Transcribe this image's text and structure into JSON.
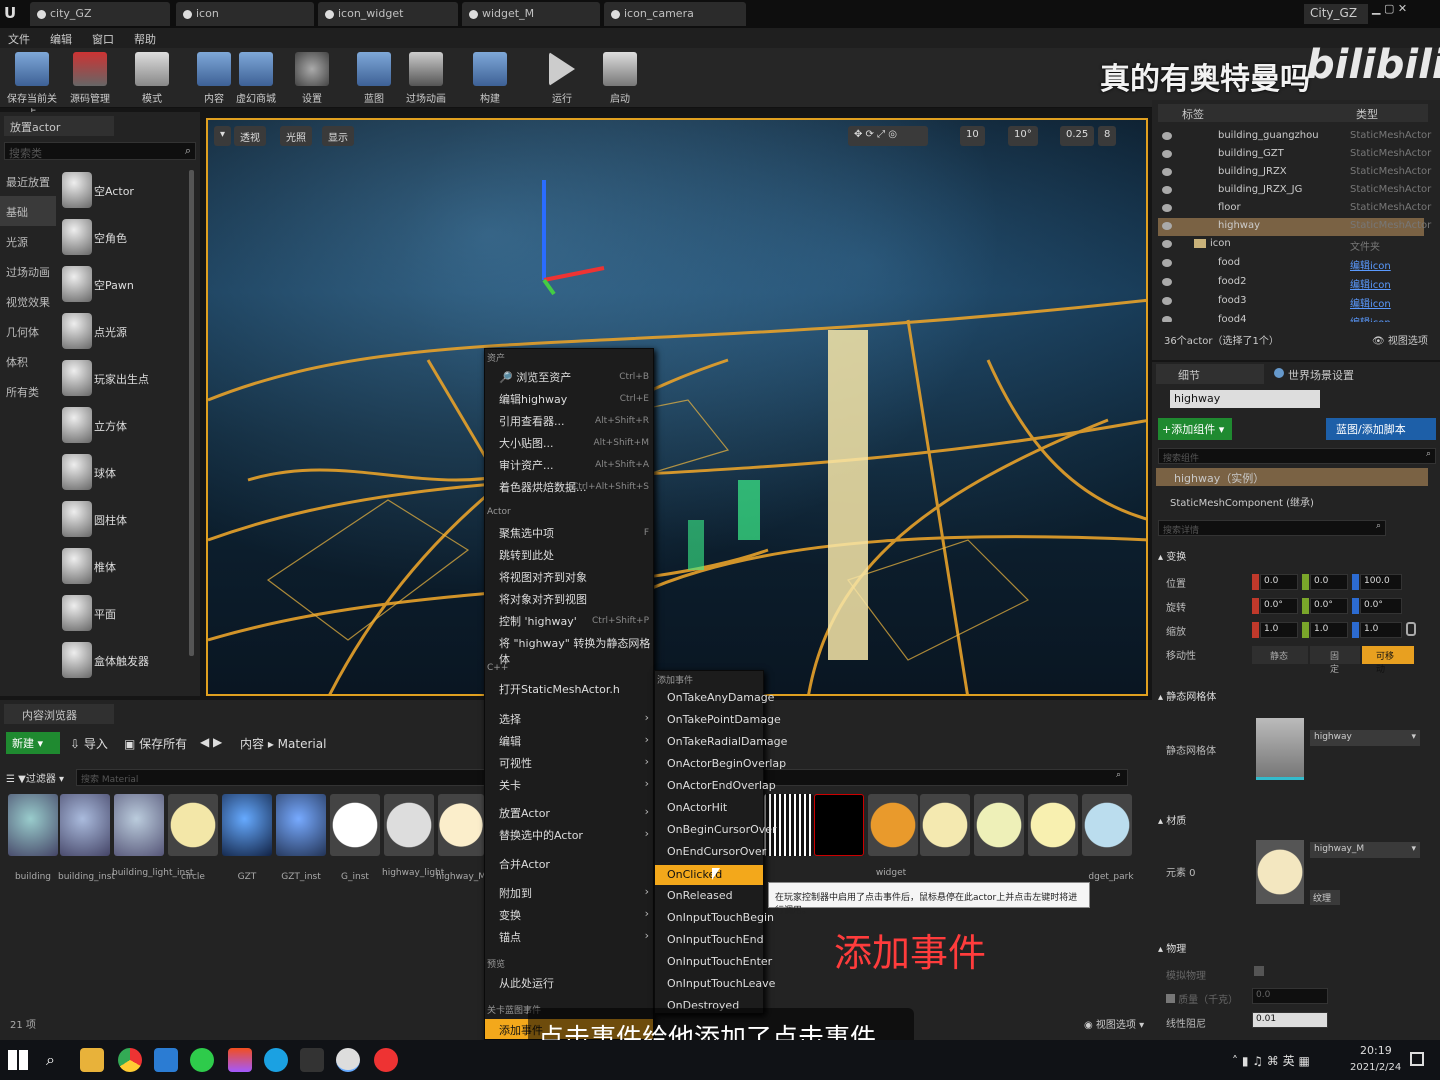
{
  "tabs": [
    "city_GZ",
    "icon",
    "icon_widget",
    "widget_M",
    "icon_camera"
  ],
  "window_title": "City_GZ",
  "menu": [
    "文件",
    "编辑",
    "窗口",
    "帮助"
  ],
  "toolbar": [
    "保存当前关卡",
    "源码管理",
    "模式",
    "内容",
    "虚幻商城",
    "设置",
    "蓝图",
    "过场动画",
    "构建",
    "运行",
    "启动"
  ],
  "place_panel": {
    "title": "放置actor",
    "search_placeholder": "搜索类",
    "categories": [
      "最近放置",
      "基础",
      "光源",
      "过场动画",
      "视觉效果",
      "几何体",
      "体积",
      "所有类"
    ],
    "items": [
      "空Actor",
      "空角色",
      "空Pawn",
      "点光源",
      "玩家出生点",
      "立方体",
      "球体",
      "圆柱体",
      "椎体",
      "平面",
      "盒体触发器"
    ]
  },
  "viewport": {
    "buttons": [
      "透视",
      "光照",
      "显示"
    ],
    "snap_values": [
      "10",
      "10°",
      "0.25",
      "8"
    ]
  },
  "watermark": "真的有奥特曼吗",
  "logo": "bilibili",
  "outliner": {
    "headers": [
      "标签",
      "类型"
    ],
    "rows": [
      {
        "name": "building_guangzhou",
        "type": "StaticMeshActor"
      },
      {
        "name": "building_GZT",
        "type": "StaticMeshActor"
      },
      {
        "name": "building_JRZX",
        "type": "StaticMeshActor"
      },
      {
        "name": "building_JRZX_JG",
        "type": "StaticMeshActor"
      },
      {
        "name": "floor",
        "type": "StaticMeshActor"
      },
      {
        "name": "highway",
        "type": "StaticMeshActor"
      },
      {
        "name": "icon",
        "type": "文件夹"
      },
      {
        "name": "food",
        "type": "编辑icon"
      },
      {
        "name": "food2",
        "type": "编辑icon"
      },
      {
        "name": "food3",
        "type": "编辑icon"
      },
      {
        "name": "food4",
        "type": "编辑icon"
      }
    ],
    "count": "36个actor（选择了1个）",
    "view_options": "视图选项"
  },
  "details": {
    "tab1": "细节",
    "tab2": "世界场景设置",
    "name": "highway",
    "add_component": "+添加组件",
    "blueprint": "蓝图/添加脚本",
    "search_comp": "搜索组件",
    "instance": "highway（实例）",
    "component": "StaticMeshComponent (继承)",
    "search_detail": "搜索详情",
    "transform": "变换",
    "loc": "位置",
    "rot": "旋转",
    "scale": "缩放",
    "mobility": "移动性",
    "loc_vals": [
      "0.0",
      "0.0",
      "100.0"
    ],
    "rot_vals": [
      "0.0°",
      "0.0°",
      "0.0°"
    ],
    "scale_vals": [
      "1.0",
      "1.0",
      "1.0"
    ],
    "mob": [
      "静态",
      "固定",
      "可移动"
    ],
    "static_mesh_section": "静态网格体",
    "static_mesh_label": "静态网格体",
    "mesh_name": "highway",
    "materials": "材质",
    "element0": "元素 0",
    "mat_name": "highway_M",
    "texture": "纹理",
    "physics": "物理",
    "sim": "模拟物理",
    "mass": "质量（千克）",
    "mass_val": "0.0",
    "damping": "线性阻尼",
    "damp_val": "0.01"
  },
  "context_menu": {
    "sections": [
      "资产",
      "Actor",
      "C++",
      "预览",
      "关卡蓝图事件"
    ],
    "items": [
      {
        "label": "浏览至资产",
        "shortcut": "Ctrl+B"
      },
      {
        "label": "编辑highway",
        "shortcut": "Ctrl+E"
      },
      {
        "label": "引用查看器...",
        "shortcut": "Alt+Shift+R"
      },
      {
        "label": "大小贴图...",
        "shortcut": "Alt+Shift+M"
      },
      {
        "label": "审计资产...",
        "shortcut": "Alt+Shift+A"
      },
      {
        "label": "着色器烘焙数据...",
        "shortcut": "Ctrl+Alt+Shift+S"
      },
      {
        "label": "聚焦选中项",
        "shortcut": "F"
      },
      {
        "label": "跳转到此处",
        "shortcut": ""
      },
      {
        "label": "将视图对齐到对象",
        "shortcut": ""
      },
      {
        "label": "将对象对齐到视图",
        "shortcut": ""
      },
      {
        "label": "控制 'highway'",
        "shortcut": "Ctrl+Shift+P"
      },
      {
        "label": "将 \"highway\" 转换为静态网格体",
        "shortcut": ""
      },
      {
        "label": "打开StaticMeshActor.h",
        "shortcut": ""
      },
      {
        "label": "选择",
        "shortcut": ""
      },
      {
        "label": "编辑",
        "shortcut": ""
      },
      {
        "label": "可视性",
        "shortcut": ""
      },
      {
        "label": "关卡",
        "shortcut": ""
      },
      {
        "label": "放置Actor",
        "shortcut": ""
      },
      {
        "label": "替换选中的Actor",
        "shortcut": ""
      },
      {
        "label": "合并Actor",
        "shortcut": ""
      },
      {
        "label": "附加到",
        "shortcut": ""
      },
      {
        "label": "变换",
        "shortcut": ""
      },
      {
        "label": "锚点",
        "shortcut": ""
      },
      {
        "label": "从此处运行",
        "shortcut": ""
      },
      {
        "label": "添加事件",
        "shortcut": ""
      }
    ]
  },
  "submenu": {
    "title": "添加事件",
    "items": [
      "OnTakeAnyDamage",
      "OnTakePointDamage",
      "OnTakeRadialDamage",
      "OnActorBeginOverlap",
      "OnActorEndOverlap",
      "OnActorHit",
      "OnBeginCursorOver",
      "OnEndCursorOver",
      "OnClicked",
      "OnReleased",
      "OnInputTouchBegin",
      "OnInputTouchEnd",
      "OnInputTouchEnter",
      "OnInputTouchLeave",
      "OnDestroyed"
    ],
    "selected": "OnClicked"
  },
  "tooltip": "在玩家控制器中启用了点击事件后，鼠标悬停在此actor上并点击左键时将进行调用。",
  "annotation": "添加事件",
  "subtitle": "点击事件给他添加了点击事件",
  "content_browser": {
    "title": "内容浏览器",
    "new": "新建",
    "import": "导入",
    "save_all": "保存所有",
    "path_root": "内容",
    "path_current": "Material",
    "filter": "过滤器",
    "search_placeholder": "搜索 Material",
    "count": "21 项",
    "view_options": "视图选项",
    "assets": [
      "building",
      "building_inst",
      "building_light_inst",
      "circle",
      "GZT",
      "GZT_inst",
      "G_inst",
      "highway_light",
      "highway_M",
      "widget",
      "dget_park"
    ]
  },
  "taskbar": {
    "time": "20:19",
    "date": "2021/2/24",
    "ime": "英"
  }
}
